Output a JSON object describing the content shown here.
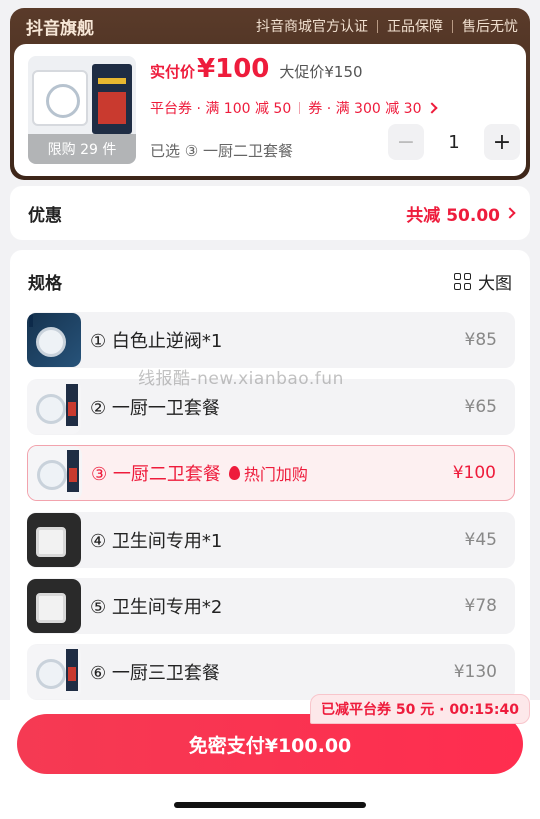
{
  "store": {
    "name": "抖音旗舰",
    "tags": [
      "抖音商城官方认证",
      "正品保障",
      "售后无忧"
    ]
  },
  "product": {
    "limit_text": "限购 29 件",
    "price_label": "实付价",
    "price_value": "¥100",
    "promo_price": "大促价¥150",
    "platform_coupon": "平台券 · 满 100 减 50",
    "shop_coupon": "券 · 满 300 减 30",
    "selected_text": "已选 ③ 一厨二卫套餐",
    "quantity": "1",
    "minus_symbol": "−",
    "plus_symbol": "+"
  },
  "discount": {
    "label": "优惠",
    "value": "共减 50.00"
  },
  "spec": {
    "title": "规格",
    "big_image_label": "大图",
    "options": [
      {
        "label": "① 白色止逆阀*1",
        "price": "¥85",
        "hot": ""
      },
      {
        "label": "② 一厨一卫套餐",
        "price": "¥65",
        "hot": ""
      },
      {
        "label": "③ 一厨二卫套餐",
        "price": "¥100",
        "hot": "热门加购"
      },
      {
        "label": "④ 卫生间专用*1",
        "price": "¥45",
        "hot": ""
      },
      {
        "label": "⑤ 卫生间专用*2",
        "price": "¥78",
        "hot": ""
      },
      {
        "label": "⑥ 一厨三卫套餐",
        "price": "¥130",
        "hot": ""
      }
    ],
    "selected_index": 2
  },
  "watermark": "线报酷-new.xianbao.fun",
  "bottom": {
    "countdown": "已减平台券 50 元 · 00:15:40",
    "pay_label": "免密支付¥100.00"
  },
  "colors": {
    "accent": "#ee1c3c",
    "store_header": "#4a2f20"
  },
  "icons": [
    "chevron-right-icon",
    "grid-icon",
    "flame-icon",
    "minus-icon",
    "plus-icon"
  ]
}
